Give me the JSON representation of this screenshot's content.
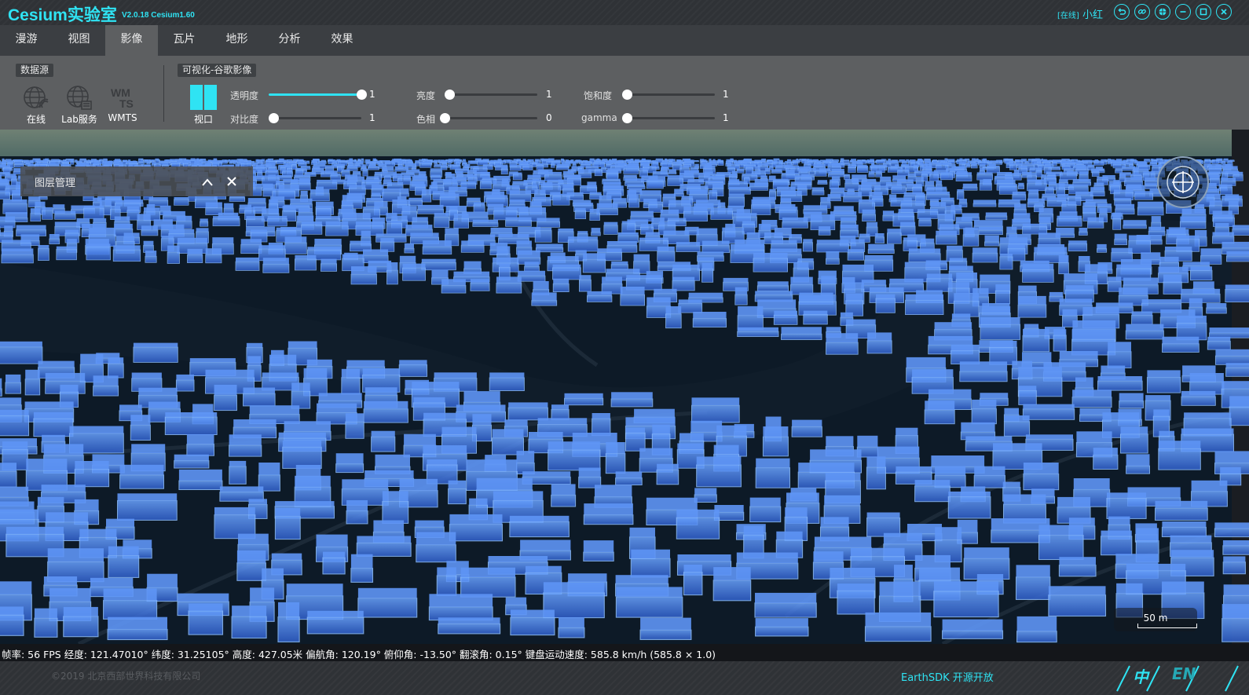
{
  "app": {
    "title": "Cesium实验室",
    "version": "V2.0.18  Cesium1.60"
  },
  "user": {
    "status": "[在线]",
    "name": "小红"
  },
  "window_buttons": [
    "undo-icon",
    "link-icon",
    "globe-icon",
    "minimize-icon",
    "maximize-icon",
    "close-icon"
  ],
  "menu": {
    "items": [
      "漫游",
      "视图",
      "影像",
      "瓦片",
      "地形",
      "分析",
      "效果"
    ],
    "active": "影像"
  },
  "toolbar": {
    "datasource_label": "数据源",
    "tools": [
      {
        "label": "在线",
        "icon": "globe-wifi-icon"
      },
      {
        "label": "Lab服务",
        "icon": "globe-server-icon"
      },
      {
        "label": "WMTS",
        "icon": "wmts-icon"
      }
    ],
    "layer_label": "可视化-谷歌影像",
    "viewport_label": "视口",
    "sliders": [
      {
        "label": "透明度",
        "value": "1",
        "fraction": 1.0
      },
      {
        "label": "对比度",
        "value": "1",
        "fraction": 0.05
      },
      {
        "label": "亮度",
        "value": "1",
        "fraction": 0.05
      },
      {
        "label": "色相",
        "value": "0",
        "fraction": 0.0
      },
      {
        "label": "饱和度",
        "value": "1",
        "fraction": 0.05
      },
      {
        "label": "gamma",
        "value": "1",
        "fraction": 0.05
      }
    ]
  },
  "layer_panel": {
    "title": "图层管理"
  },
  "scale": {
    "label": "50 m"
  },
  "status": {
    "text": "帧率: 56 FPS 经度: 121.47010° 纬度: 31.25105° 高度: 427.05米 偏航角: 120.19° 俯仰角: -13.50° 翻滚角: 0.15° 键盘运动速度: 585.8 km/h (585.8 × 1.0)"
  },
  "footer": {
    "copyright": "©2019 北京西部世界科技有限公司",
    "sdk": "EarthSDK 开源开放",
    "lang_zh": "中",
    "lang_en": "EN"
  },
  "colors": {
    "accent": "#2fe3f3",
    "building": "#3f7fe8",
    "ground": "#0d1a27"
  }
}
